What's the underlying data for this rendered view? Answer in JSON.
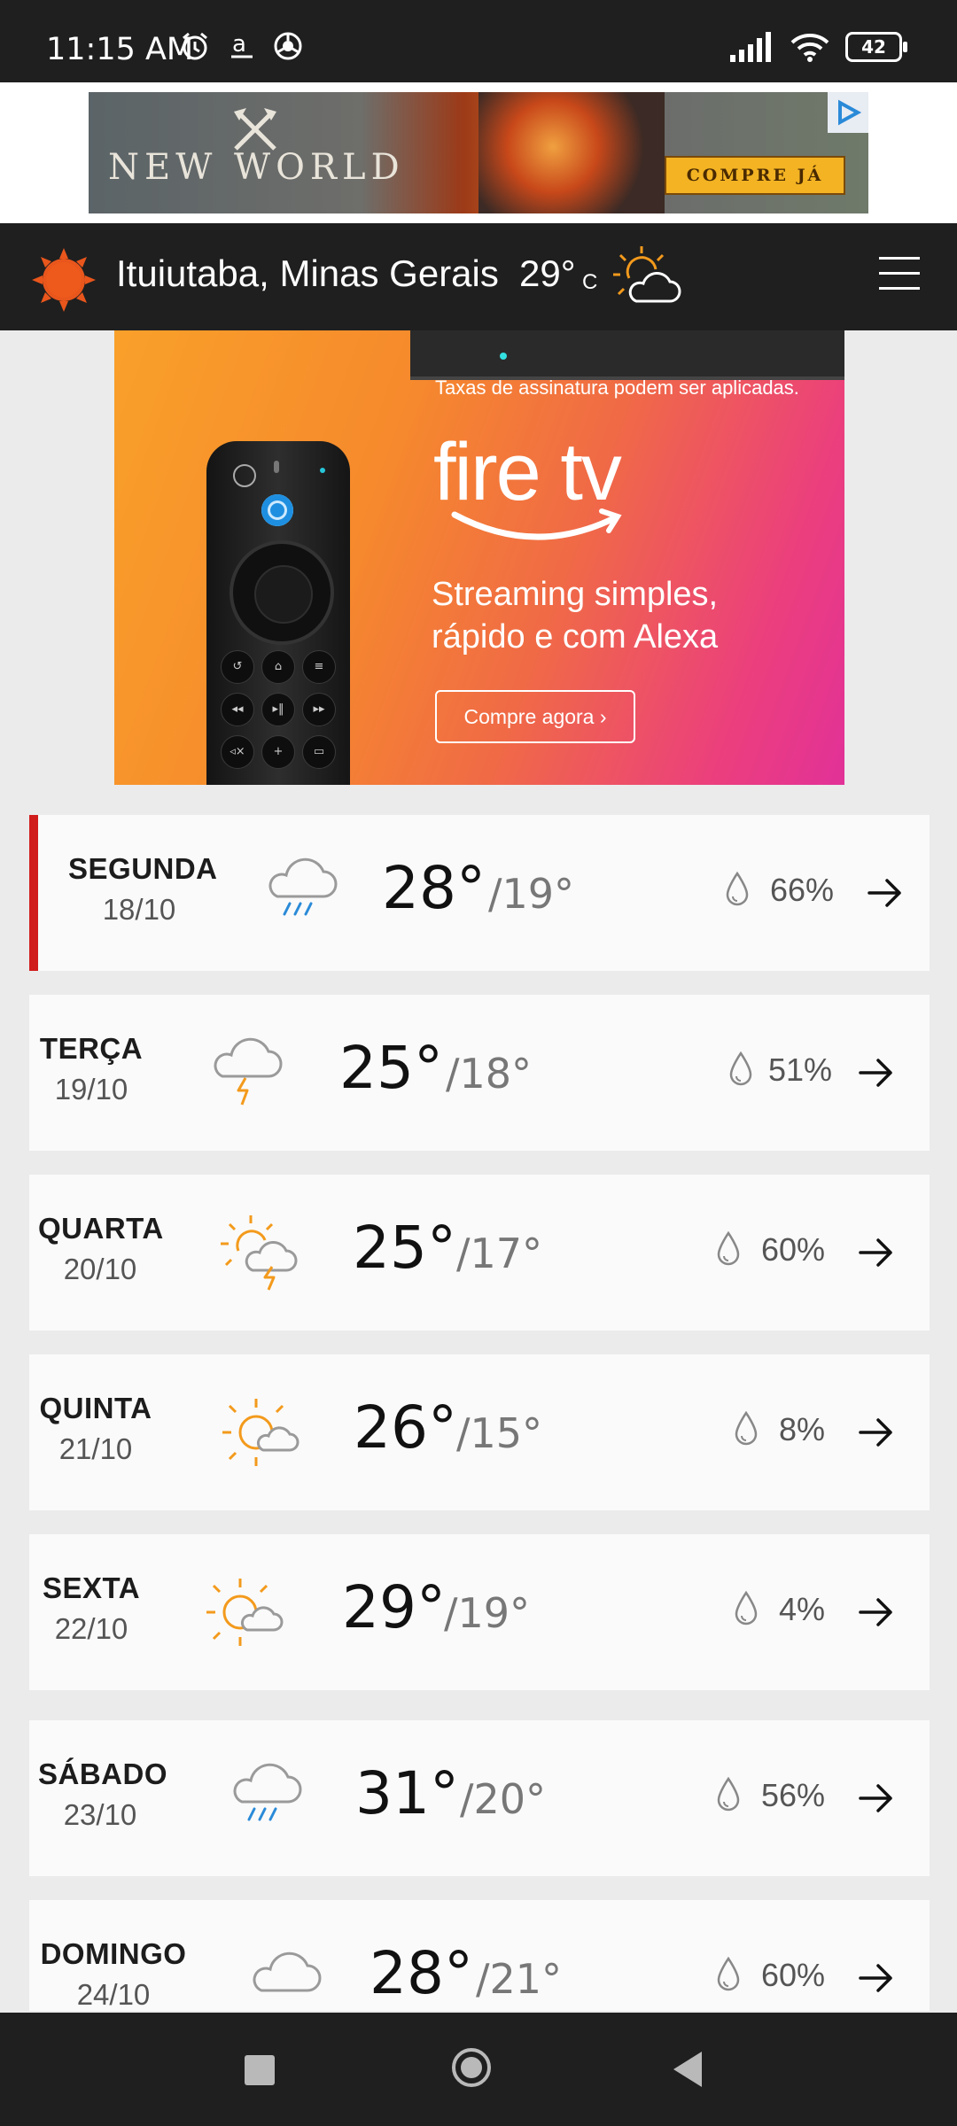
{
  "status_bar": {
    "time": "11:15 AM",
    "battery": "42"
  },
  "top_ad": {
    "brand": "NEW WORLD",
    "cta": "COMPRE JÁ"
  },
  "header": {
    "location": "Ituiutaba, Minas Gerais",
    "temperature": "29°",
    "unit": "C"
  },
  "fire_ad": {
    "disclaimer": "Taxas de assinatura podem ser aplicadas.",
    "brand": "fire tv",
    "tagline_1": "Streaming simples,",
    "tagline_2": "rápido e com Alexa",
    "cta": "Compre agora ›"
  },
  "forecast": [
    {
      "day": "SEGUNDA",
      "date": "18/10",
      "high": "28°",
      "low": "/19°",
      "rain": "66%",
      "icon": "rain-cloud-icon"
    },
    {
      "day": "TERÇA",
      "date": "19/10",
      "high": "25°",
      "low": "/18°",
      "rain": "51%",
      "icon": "thunder-cloud-icon"
    },
    {
      "day": "QUARTA",
      "date": "20/10",
      "high": "25°",
      "low": "/17°",
      "rain": "60%",
      "icon": "sun-cloud-thunder-icon"
    },
    {
      "day": "QUINTA",
      "date": "21/10",
      "high": "26°",
      "low": "/15°",
      "rain": "8%",
      "icon": "sun-cloud-icon"
    },
    {
      "day": "SEXTA",
      "date": "22/10",
      "high": "29°",
      "low": "/19°",
      "rain": "4%",
      "icon": "sun-cloud-icon"
    },
    {
      "day": "SÁBADO",
      "date": "23/10",
      "high": "31°",
      "low": "/20°",
      "rain": "56%",
      "icon": "rain-cloud-icon"
    },
    {
      "day": "DOMINGO",
      "date": "24/10",
      "high": "28°",
      "low": "/21°",
      "rain": "60%",
      "icon": "cloud-icon"
    }
  ],
  "colors": {
    "accent_today": "#d11c1c",
    "sun": "#f39a1c",
    "rain": "#2a8ad8",
    "header_bg": "#1f1f1f"
  }
}
